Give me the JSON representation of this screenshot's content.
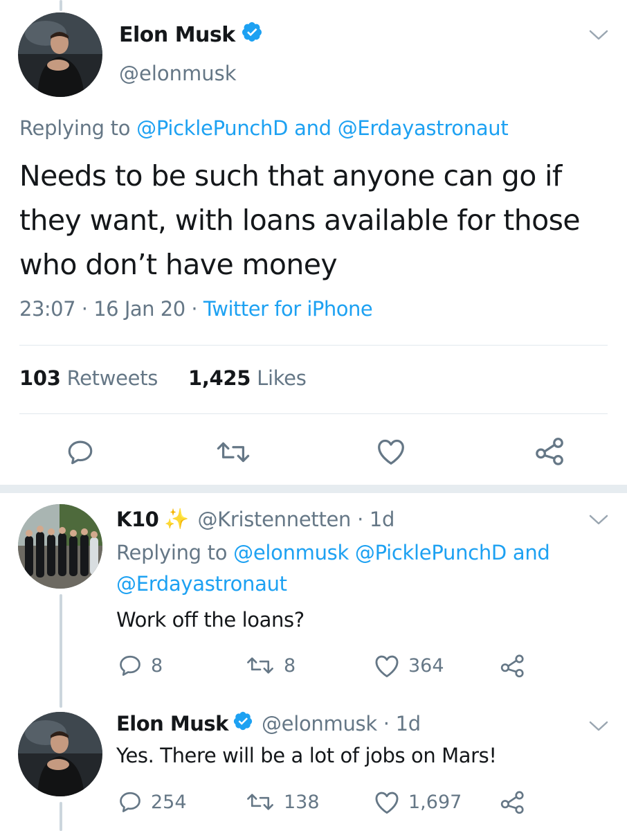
{
  "main_tweet": {
    "name": "Elon Musk",
    "handle": "@elonmusk",
    "replying_prefix": "Replying to",
    "replying_user1": "@PicklePunchD",
    "replying_and": "and",
    "replying_user2": "@Erdayastronaut",
    "text": "Needs to be such that anyone can go if they want, with loans available for those who don’t have money",
    "time": "23:07",
    "date": "16 Jan 20",
    "source": "Twitter for iPhone",
    "retweets_count": "103",
    "retweets_label": "Retweets",
    "likes_count": "1,425",
    "likes_label": "Likes"
  },
  "replies": [
    {
      "name": "K10",
      "emoji": "✨",
      "handle": "@Kristennetten",
      "age": "1d",
      "replying_prefix": "Replying to",
      "replying_users": "@elonmusk @PicklePunchD",
      "replying_and": "and",
      "replying_last": "@Erdayastronaut",
      "text": "Work off the loans?",
      "replies": "8",
      "retweets": "8",
      "likes": "364"
    },
    {
      "name": "Elon Musk",
      "handle": "@elonmusk",
      "age": "1d",
      "text": "Yes. There will be a lot of jobs on Mars!",
      "replies": "254",
      "retweets": "138",
      "likes": "1,697"
    }
  ],
  "colors": {
    "link": "#1da1f2",
    "secondary": "#657786",
    "verified": "#1da1f2",
    "divider": "#e1e8ed"
  },
  "icons": [
    "verified-badge-icon",
    "chevron-down-icon",
    "reply-icon",
    "retweet-icon",
    "like-icon",
    "share-icon",
    "sparkles-emoji"
  ]
}
